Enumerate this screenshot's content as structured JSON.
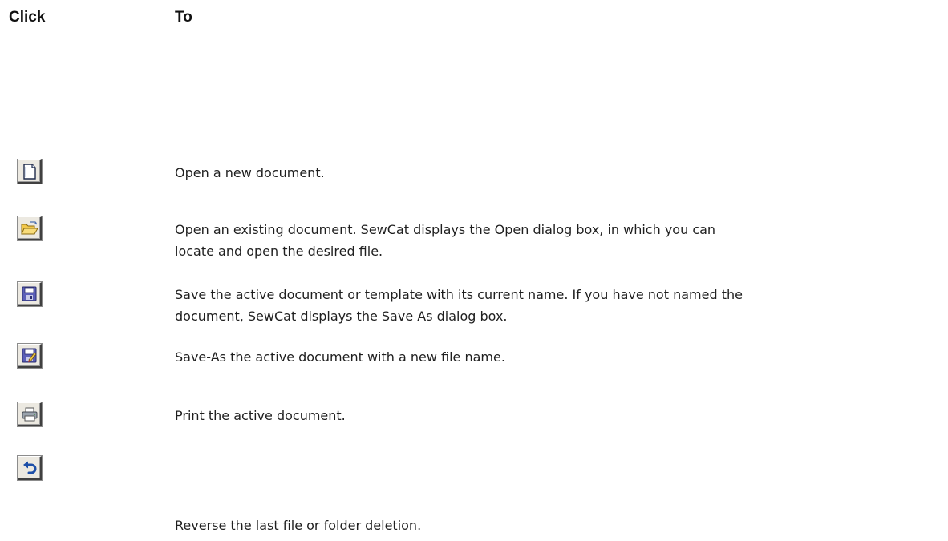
{
  "header": {
    "click_label": "Click",
    "to_label": "To"
  },
  "rows": [
    {
      "icon": "new-document-icon",
      "lines": [
        "Open a new document."
      ]
    },
    {
      "icon": "open-folder-icon",
      "lines": [
        "Open an existing document. SewCat displays the Open dialog box, in which you can",
        "locate and open the desired file."
      ]
    },
    {
      "icon": "save-floppy-icon",
      "lines": [
        "Save the active document or template with its current name.  If you have not named the",
        "document, SewCat displays the Save As dialog box."
      ]
    },
    {
      "icon": "save-as-icon",
      "lines": [
        "Save-As the active document with a new file name."
      ]
    },
    {
      "icon": "printer-icon",
      "lines": [
        "Print the active document."
      ]
    },
    {
      "icon": "undo-icon",
      "lines": [
        "Reverse the last file or folder deletion."
      ]
    }
  ]
}
